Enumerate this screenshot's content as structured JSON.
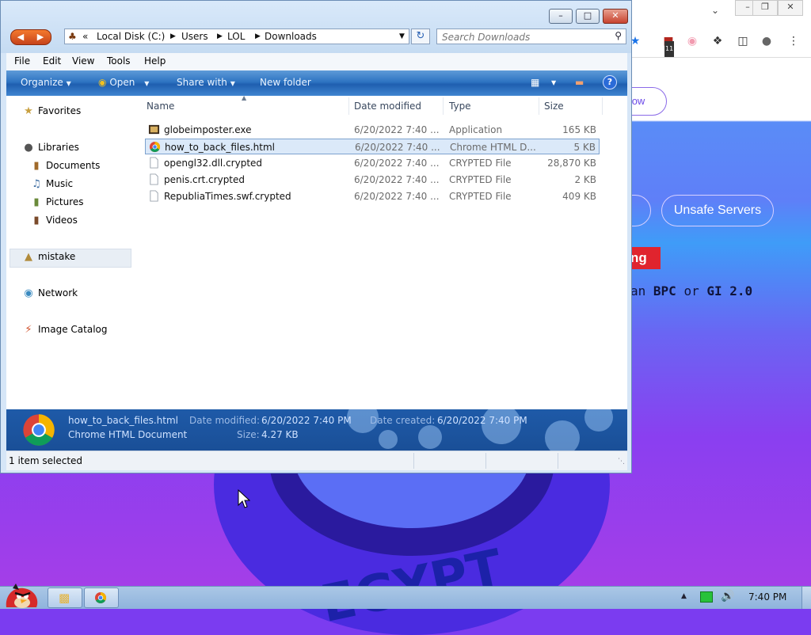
{
  "explorer": {
    "address": {
      "crumbs": [
        "Local Disk (C:)",
        "Users",
        "LOL",
        "Downloads"
      ]
    },
    "search": {
      "placeholder": "Search Downloads"
    },
    "menu": [
      "File",
      "Edit",
      "View",
      "Tools",
      "Help"
    ],
    "commands": {
      "organize": "Organize",
      "open": "Open",
      "share_with": "Share with",
      "new_folder": "New folder"
    },
    "nav": {
      "favorites": "Favorites",
      "libraries": "Libraries",
      "documents": "Documents",
      "music": "Music",
      "pictures": "Pictures",
      "videos": "Videos",
      "user": "mistake",
      "network": "Network",
      "image_catalog": "Image Catalog"
    },
    "columns": {
      "name": "Name",
      "date": "Date modified",
      "type": "Type",
      "size": "Size"
    },
    "files": [
      {
        "name": "globeimposter.exe",
        "date": "6/20/2022 7:40 ...",
        "type": "Application",
        "size": "165 KB",
        "icon": "app-icon"
      },
      {
        "name": "how_to_back_files.html",
        "date": "6/20/2022 7:40 ...",
        "type": "Chrome HTML D...",
        "size": "5 KB",
        "icon": "chrome-icon",
        "selected": true
      },
      {
        "name": "opengl32.dll.crypted",
        "date": "6/20/2022 7:40 ...",
        "type": "CRYPTED File",
        "size": "28,870 KB",
        "icon": "blank-file-icon"
      },
      {
        "name": "penis.crt.crypted",
        "date": "6/20/2022 7:40 ...",
        "type": "CRYPTED File",
        "size": "2 KB",
        "icon": "blank-file-icon"
      },
      {
        "name": "RepubliaTimes.swf.crypted",
        "date": "6/20/2022 7:40 ...",
        "type": "CRYPTED File",
        "size": "409 KB",
        "icon": "blank-file-icon"
      }
    ],
    "details": {
      "filename": "how_to_back_files.html",
      "filetype": "Chrome HTML Document",
      "modified_label": "Date modified:",
      "modified_value": "6/20/2022 7:40 PM",
      "created_label": "Date created:",
      "created_value": "6/20/2022 7:40 PM",
      "size_label": "Size:",
      "size_value": "4.27 KB"
    },
    "status": "1 item selected"
  },
  "browser": {
    "pill_top": "ow",
    "unsafe_button": "Unsafe Servers",
    "warn_tag": "ng",
    "warn_line_prefix": "an ",
    "warn_bpc": "BPC",
    "warn_or": " or ",
    "warn_gi": "GI 2.0",
    "egypt": "EGYPT",
    "ext_badge": "11"
  },
  "taskbar": {
    "clock": "7:40 PM"
  },
  "colors": {
    "cmdbar": "#2e74c2",
    "details": "#1e5aa8",
    "accent_red": "#e0242e"
  }
}
